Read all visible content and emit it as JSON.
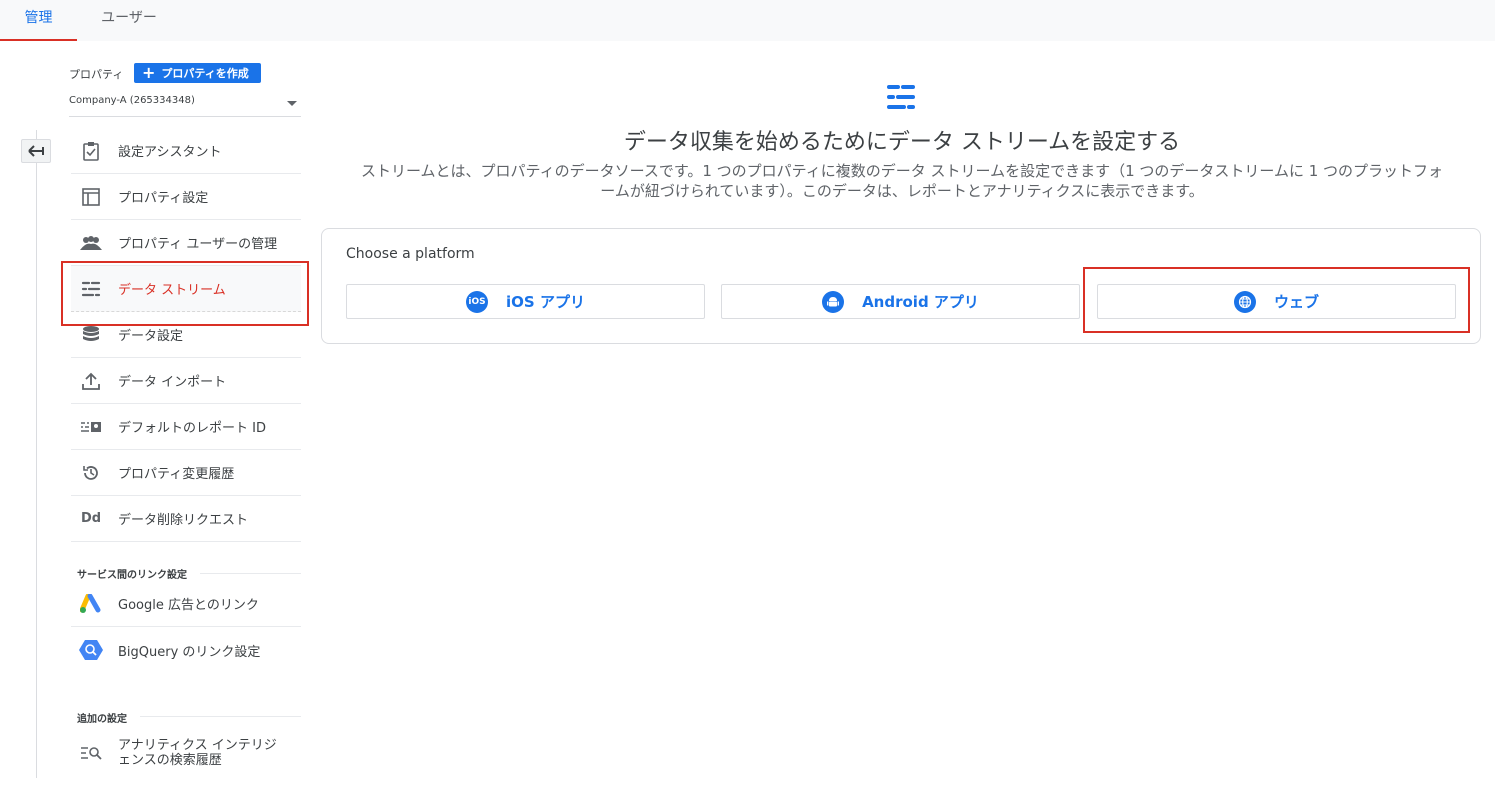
{
  "tabs": [
    {
      "label": "管理",
      "active": true
    },
    {
      "label": "ユーザー",
      "active": false
    }
  ],
  "property": {
    "label": "プロパティ",
    "create_button": "プロパティを作成",
    "selected": "Company-A (265334348)"
  },
  "nav": {
    "items": [
      {
        "label": "設定アシスタント",
        "icon": "clipboard-check-icon"
      },
      {
        "label": "プロパティ設定",
        "icon": "layout-icon"
      },
      {
        "label": "プロパティ ユーザーの管理",
        "icon": "people-icon"
      },
      {
        "label": "データ ストリーム",
        "icon": "data-streams-icon",
        "active": true
      },
      {
        "label": "データ設定",
        "icon": "database-icon"
      },
      {
        "label": "データ インポート",
        "icon": "upload-icon"
      },
      {
        "label": "デフォルトのレポート ID",
        "icon": "report-id-icon"
      },
      {
        "label": "プロパティ変更履歴",
        "icon": "history-icon"
      },
      {
        "label": "データ削除リクエスト",
        "icon": "dd-icon"
      }
    ],
    "links_section": "サービス間のリンク設定",
    "links": [
      {
        "label": "Google 広告とのリンク",
        "icon": "google-ads-icon"
      },
      {
        "label": "BigQuery のリンク設定",
        "icon": "bigquery-icon"
      }
    ],
    "extra_section": "追加の設定",
    "extra_item_line1": "アナリティクス インテリジ",
    "extra_item_line2": "ェンスの検索履歴"
  },
  "main": {
    "title": "データ収集を始めるためにデータ ストリームを設定する",
    "desc_line1": "ストリームとは、プロパティのデータソースです。1 つのプロパティに複数のデータ ストリームを設定できます（1 つのデータストリームに 1 つのプラットフォ",
    "desc_line2": "ームが紐づけられています）。このデータは、レポートとアナリティクスに表示できます。",
    "card_title": "Choose a platform",
    "platforms": [
      {
        "label": "iOS アプリ",
        "icon": "ios-icon",
        "badge": "iOS"
      },
      {
        "label": "Android アプリ",
        "icon": "android-icon"
      },
      {
        "label": "ウェブ",
        "icon": "globe-icon"
      }
    ]
  },
  "colors": {
    "accent": "#1a73e8",
    "highlight": "#d93025"
  }
}
